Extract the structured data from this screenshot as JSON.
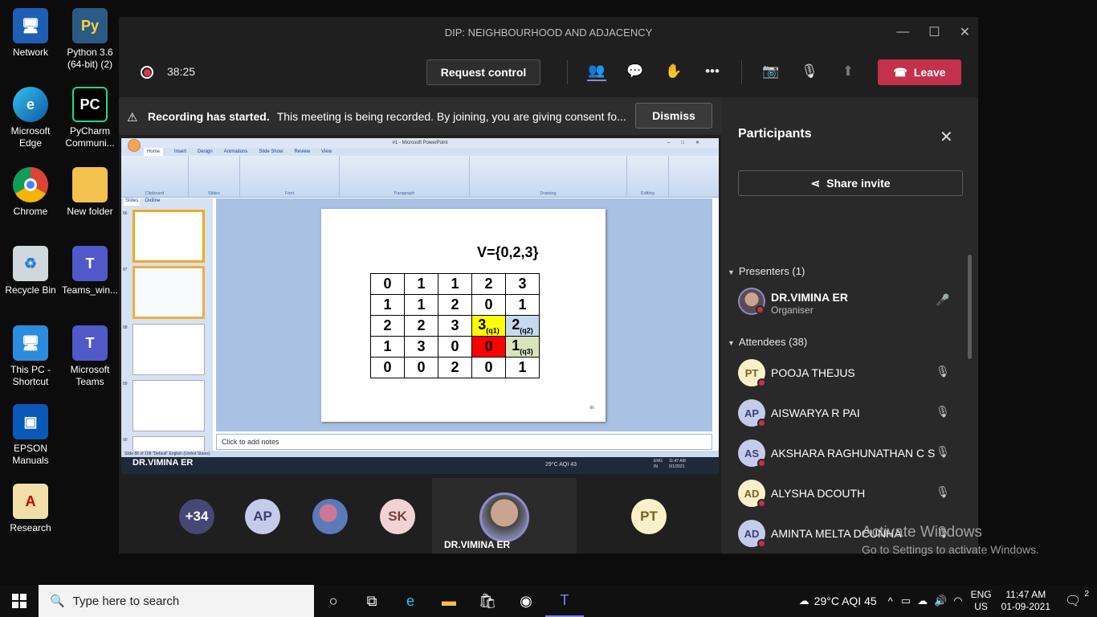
{
  "desktop": {
    "icons": [
      {
        "label": "Network"
      },
      {
        "label": "Python 3.6 (64-bit) (2)"
      },
      {
        "label": "Microsoft Edge"
      },
      {
        "label": "PyCharm Communi..."
      },
      {
        "label": "Chrome"
      },
      {
        "label": "New folder"
      },
      {
        "label": "Recycle Bin"
      },
      {
        "label": "Teams_win..."
      },
      {
        "label": "This PC - Shortcut"
      },
      {
        "label": "Microsoft Teams"
      },
      {
        "label": "EPSON Manuals"
      },
      {
        "label": "Research"
      }
    ],
    "watermark": {
      "line1": "Activate Windows",
      "line2": "Go to Settings to activate Windows."
    }
  },
  "teams": {
    "window_title": "DIP: NEIGHBOURHOOD AND ADJACENCY",
    "timer": "38:25",
    "request_control": "Request control",
    "leave": "Leave",
    "banner": {
      "bold": "Recording has started.",
      "text": "This meeting is being recorded. By joining, you are giving consent fo...",
      "dismiss": "Dismiss"
    },
    "participants_panel": {
      "title": "Participants",
      "share_invite": "Share invite",
      "presenters_header": "Presenters (1)",
      "presenter": {
        "name": "DR.VIMINA ER",
        "role": "Organiser"
      },
      "attendees_header": "Attendees (38)",
      "attendees": [
        {
          "initials": "PT",
          "name": "POOJA THEJUS"
        },
        {
          "initials": "AP",
          "name": "AISWARYA R PAI"
        },
        {
          "initials": "AS",
          "name": "AKSHARA RAGHUNATHAN C S"
        },
        {
          "initials": "AD",
          "name": "ALYSHA DCOUTH"
        },
        {
          "initials": "AD",
          "name": "AMINTA MELTA DCUNHA"
        }
      ]
    },
    "strip": {
      "overflow": "+34",
      "avatars": [
        "AP",
        "SK"
      ],
      "active_speaker": "DR.VIMINA ER",
      "last": "PT"
    }
  },
  "shared_screen": {
    "ppt_title": "#1 - Microsoft PowerPoint",
    "tabs": [
      "Home",
      "Insert",
      "Design",
      "Animations",
      "Slide Show",
      "Review",
      "View"
    ],
    "ribbon_groups": [
      "Clipboard",
      "Slides",
      "Font",
      "Paragraph",
      "Drawing",
      "Editing"
    ],
    "pane_tabs": [
      "Slides",
      "Outline"
    ],
    "thumb_numbers": [
      "86",
      "87",
      "88",
      "89",
      "90"
    ],
    "slide": {
      "vset": "V={0,2,3}",
      "grid": [
        [
          "0",
          "1",
          "1",
          "2",
          "3"
        ],
        [
          "1",
          "1",
          "2",
          "0",
          "1"
        ],
        [
          "2",
          "2",
          "3",
          "3",
          "2"
        ],
        [
          "1",
          "3",
          "0",
          "0",
          "1"
        ],
        [
          "0",
          "0",
          "2",
          "0",
          "1"
        ]
      ],
      "q1": "(q1)",
      "q2": "(q2)",
      "q3": "(q3)",
      "page_no": "86"
    },
    "notes": "Click to add notes",
    "status": "Slide 86 of 108     \"Default\"     English (United States)",
    "presenter_label": "DR.VIMINA ER",
    "inner_clock": "11:47 AM 9/1/2021",
    "inner_weather": "29°C AQI 43",
    "inner_lang": "ENG IN"
  },
  "taskbar": {
    "search_placeholder": "Type here to search",
    "weather": "29°C  AQI 45",
    "lang1": "ENG",
    "lang2": "US",
    "time": "11:47 AM",
    "date": "01-09-2021",
    "notifications": "2"
  }
}
